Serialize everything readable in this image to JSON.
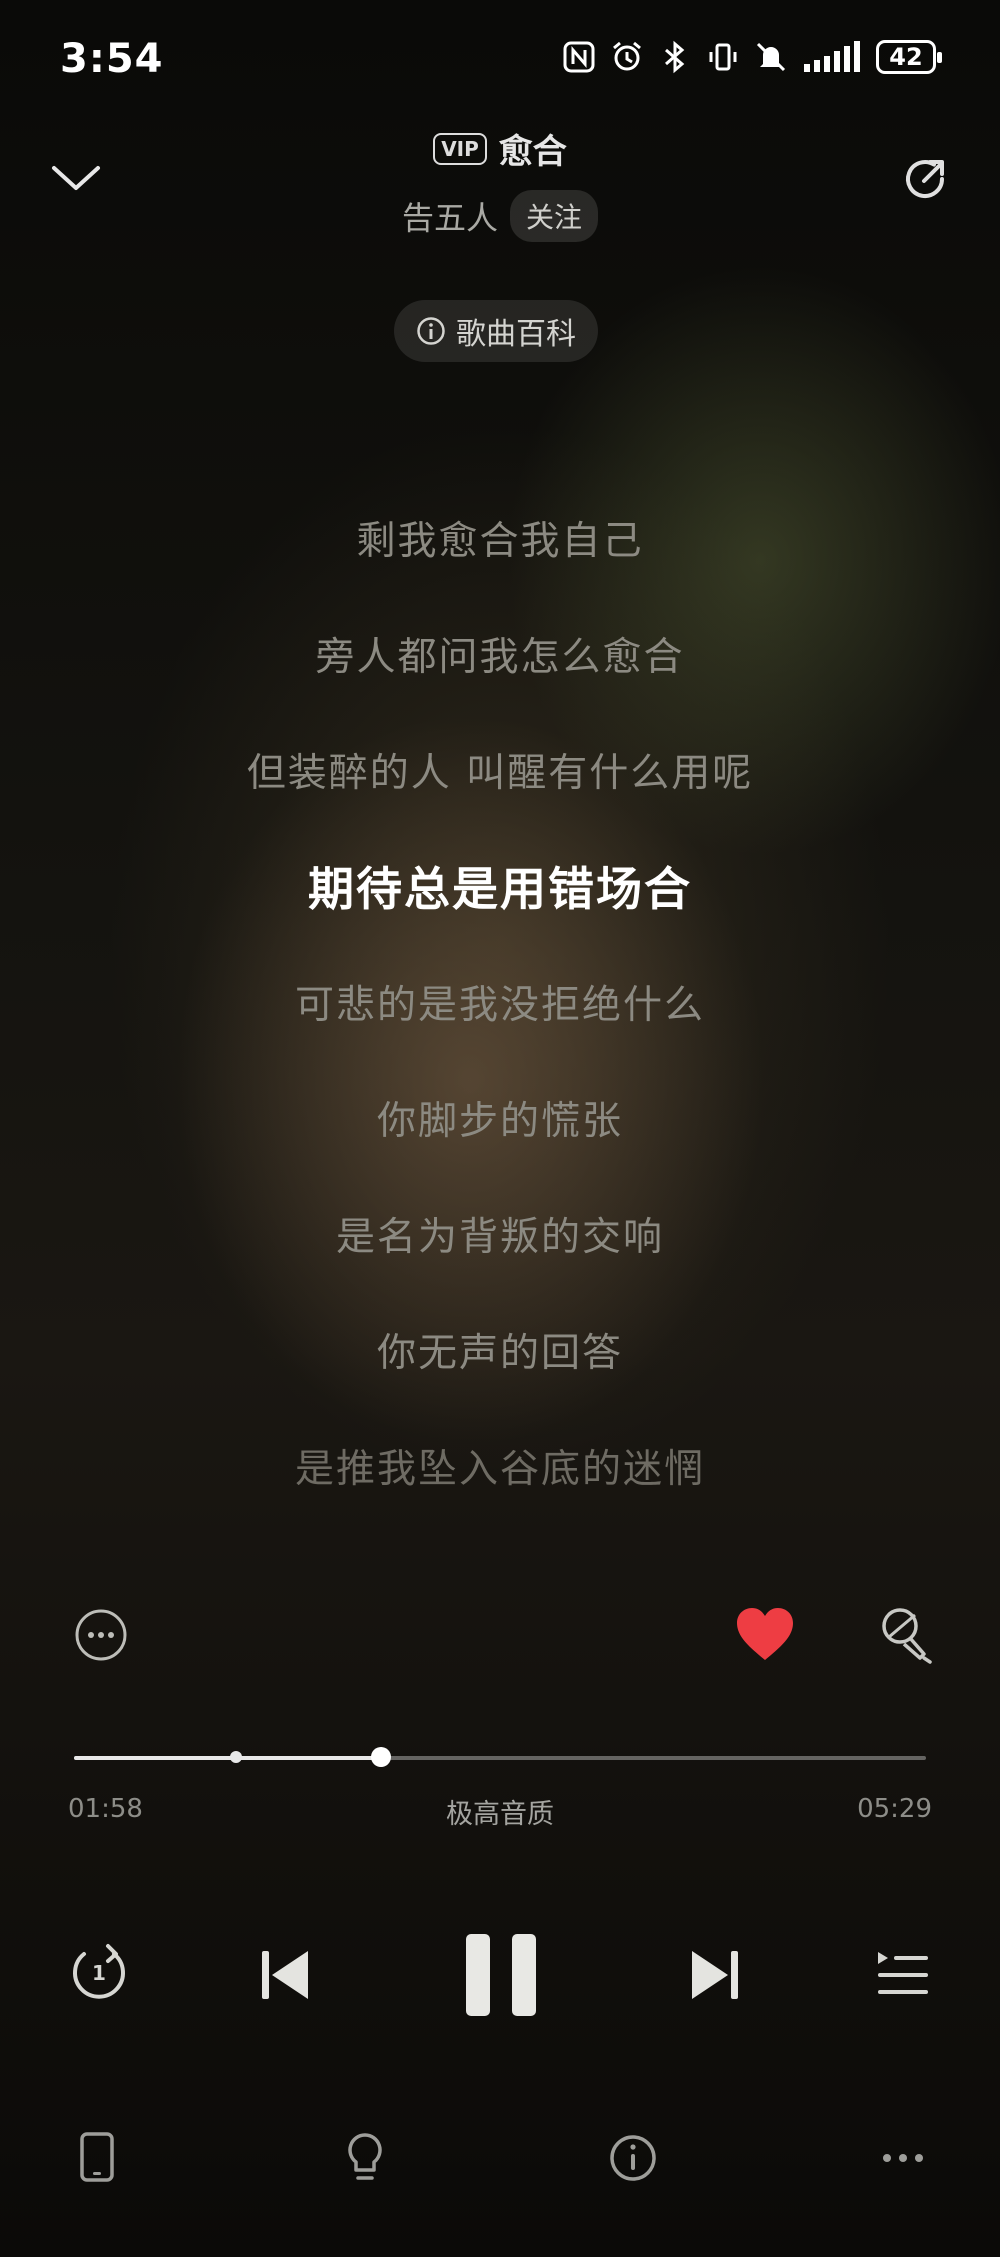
{
  "status_bar": {
    "time": "3:54",
    "battery": "42",
    "icons": [
      "nfc-icon",
      "alarm-icon",
      "bluetooth-icon",
      "vibrate-icon",
      "mute-icon",
      "signal-icon",
      "battery-icon"
    ]
  },
  "header": {
    "vip_badge": "VIP",
    "song_title": "愈合",
    "artist": "告五人",
    "follow_label": "关注",
    "wiki_label": "歌曲百科"
  },
  "lyrics": {
    "lines": [
      "剩我愈合我自己",
      "旁人都问我怎么愈合",
      "但装醉的人 叫醒有什么用呢",
      "期待总是用错场合",
      "可悲的是我没拒绝什么",
      "你脚步的慌张",
      "是名为背叛的交响",
      "你无声的回答",
      "是推我坠入谷底的迷惘"
    ],
    "active_index": 3
  },
  "player": {
    "liked": true,
    "progress_fraction": 0.36,
    "buffered_fraction": 0.19,
    "current_time": "01:58",
    "total_time": "05:29",
    "quality_label": "极高音质",
    "repeat_count": "1",
    "state": "playing"
  },
  "colors": {
    "heart": "#ee3d43",
    "active_lyric": "#ffffff",
    "inactive_lyric": "#8c8a82"
  }
}
